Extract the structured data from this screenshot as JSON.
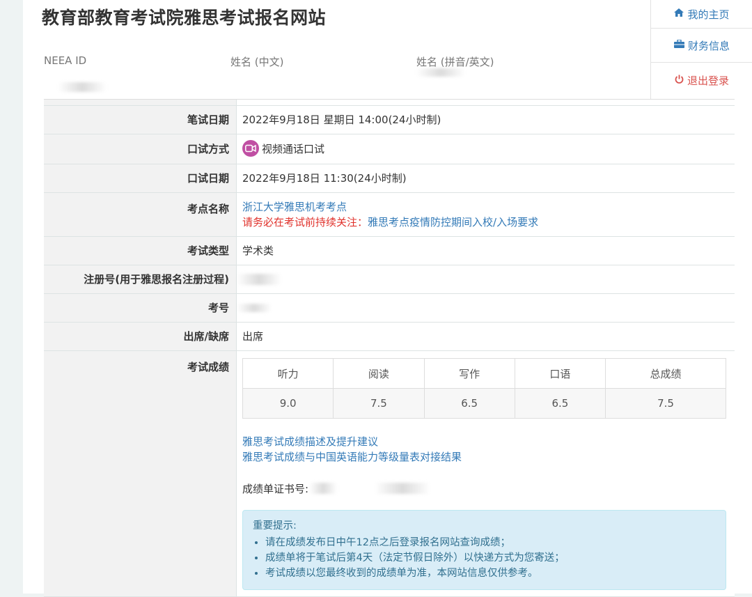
{
  "header": {
    "title": "教育部教育考试院雅思考试报名网站",
    "neea_label": "NEEA ID",
    "name_cn_label": "姓名 (中文)",
    "name_en_label": "姓名 (拼音/英文)"
  },
  "menu": {
    "home": "我的主页",
    "finance": "财务信息",
    "logout": "退出登录"
  },
  "rows": {
    "written_date": {
      "label": "笔试日期",
      "value": "2022年9月18日 星期日 14:00(24小时制)"
    },
    "speaking_mode": {
      "label": "口试方式",
      "value": "视频通话口试"
    },
    "speaking_date": {
      "label": "口试日期",
      "value": "2022年9月18日 11:30(24小时制)"
    },
    "venue": {
      "label": "考点名称",
      "value": "浙江大学雅思机考考点",
      "notice_prefix": "请务必在考试前持续关注：",
      "notice_link": "雅思考点疫情防控期间入校/入场要求"
    },
    "exam_type": {
      "label": "考试类型",
      "value": "学术类"
    },
    "reg_no": {
      "label": "注册号(用于雅思报名注册过程)",
      "value": ""
    },
    "candidate_no": {
      "label": "考号",
      "value": ""
    },
    "attendance": {
      "label": "出席/缺席",
      "value": "出席"
    },
    "scores": {
      "label": "考试成绩"
    }
  },
  "scores_table": {
    "headers": [
      "听力",
      "阅读",
      "写作",
      "口语",
      "总成绩"
    ],
    "values": [
      "9.0",
      "7.5",
      "6.5",
      "6.5",
      "7.5"
    ]
  },
  "score_links": {
    "desc": "雅思考试成绩描述及提升建议",
    "cse": "雅思考试成绩与中国英语能力等级量表对接结果"
  },
  "cert": {
    "label": "成绩单证书号:"
  },
  "notice": {
    "title": "重要提示:",
    "items": [
      "请在成绩发布日中午12点之后登录报名网站查询成绩；",
      "成绩单将于笔试后第4天（法定节假日除外）以快递方式为您寄送；",
      "考试成绩以您最终收到的成绩单为准，本网站信息仅供参考。"
    ]
  },
  "colors": {
    "link": "#337ab7",
    "logout": "#d9534f",
    "warning": "#e0312b",
    "video_icon": "#c04fa3",
    "notice_bg": "#d9edf7"
  },
  "icons": {
    "home": "home-icon",
    "finance": "briefcase-icon",
    "logout": "power-icon",
    "video": "video-camera-icon"
  }
}
